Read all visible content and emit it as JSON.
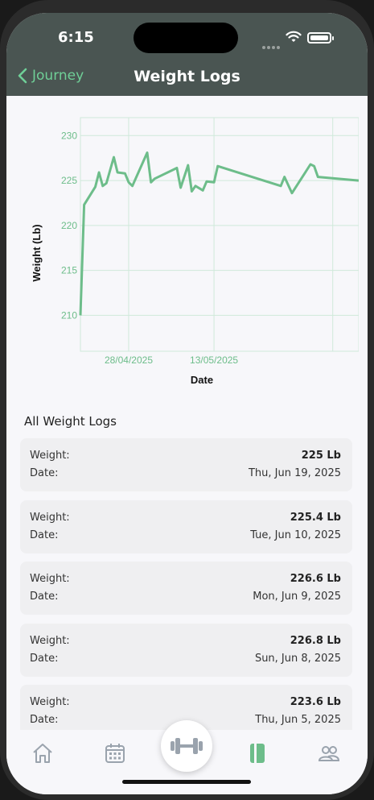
{
  "status_bar": {
    "time": "6:15"
  },
  "header": {
    "back_label": "Journey",
    "title": "Weight Logs"
  },
  "chart_data": {
    "type": "line",
    "xlabel": "Date",
    "ylabel": "Weight (Lb)",
    "y_ticks": [
      "230",
      "225",
      "220",
      "215",
      "210"
    ],
    "x_ticks": [
      "28/04/2025",
      "13/05/2025"
    ],
    "ylim": [
      206,
      232
    ],
    "grid": true,
    "line_color": "#6dbd8a",
    "series": [
      {
        "points": [
          [
            0,
            210
          ],
          [
            1,
            222.3
          ],
          [
            4,
            224.3
          ],
          [
            5,
            225.9
          ],
          [
            6,
            224.4
          ],
          [
            7,
            224.7
          ],
          [
            9,
            227.6
          ],
          [
            10,
            225.9
          ],
          [
            12,
            225.8
          ],
          [
            13,
            224.8
          ],
          [
            14,
            224.4
          ],
          [
            18,
            228.1
          ],
          [
            19,
            224.8
          ],
          [
            20,
            225.2
          ],
          [
            26,
            226.4
          ],
          [
            27,
            224.2
          ],
          [
            29,
            226.7
          ],
          [
            30,
            223.8
          ],
          [
            31,
            224.4
          ],
          [
            33,
            223.9
          ],
          [
            34,
            224.9
          ],
          [
            36,
            224.8
          ],
          [
            37,
            226.6
          ],
          [
            54,
            224.4
          ],
          [
            55,
            225.4
          ],
          [
            57,
            223.6
          ],
          [
            62,
            226.8
          ],
          [
            63,
            226.6
          ],
          [
            64,
            225.4
          ],
          [
            75,
            225
          ]
        ]
      }
    ]
  },
  "logs": {
    "section_title": "All Weight Logs",
    "weight_label": "Weight:",
    "date_label": "Date:",
    "items": [
      {
        "weight": "225 Lb",
        "date": "Thu, Jun 19, 2025"
      },
      {
        "weight": "225.4 Lb",
        "date": "Tue, Jun 10, 2025"
      },
      {
        "weight": "226.6 Lb",
        "date": "Mon, Jun 9, 2025"
      },
      {
        "weight": "226.8 Lb",
        "date": "Sun, Jun 8, 2025"
      },
      {
        "weight": "223.6 Lb",
        "date": "Thu, Jun 5, 2025"
      }
    ]
  },
  "colors": {
    "accent": "#6fcf97",
    "header_bg": "#4a5552",
    "tab_active": "#6dbd8a",
    "tab_inactive": "#9aa3ad"
  }
}
